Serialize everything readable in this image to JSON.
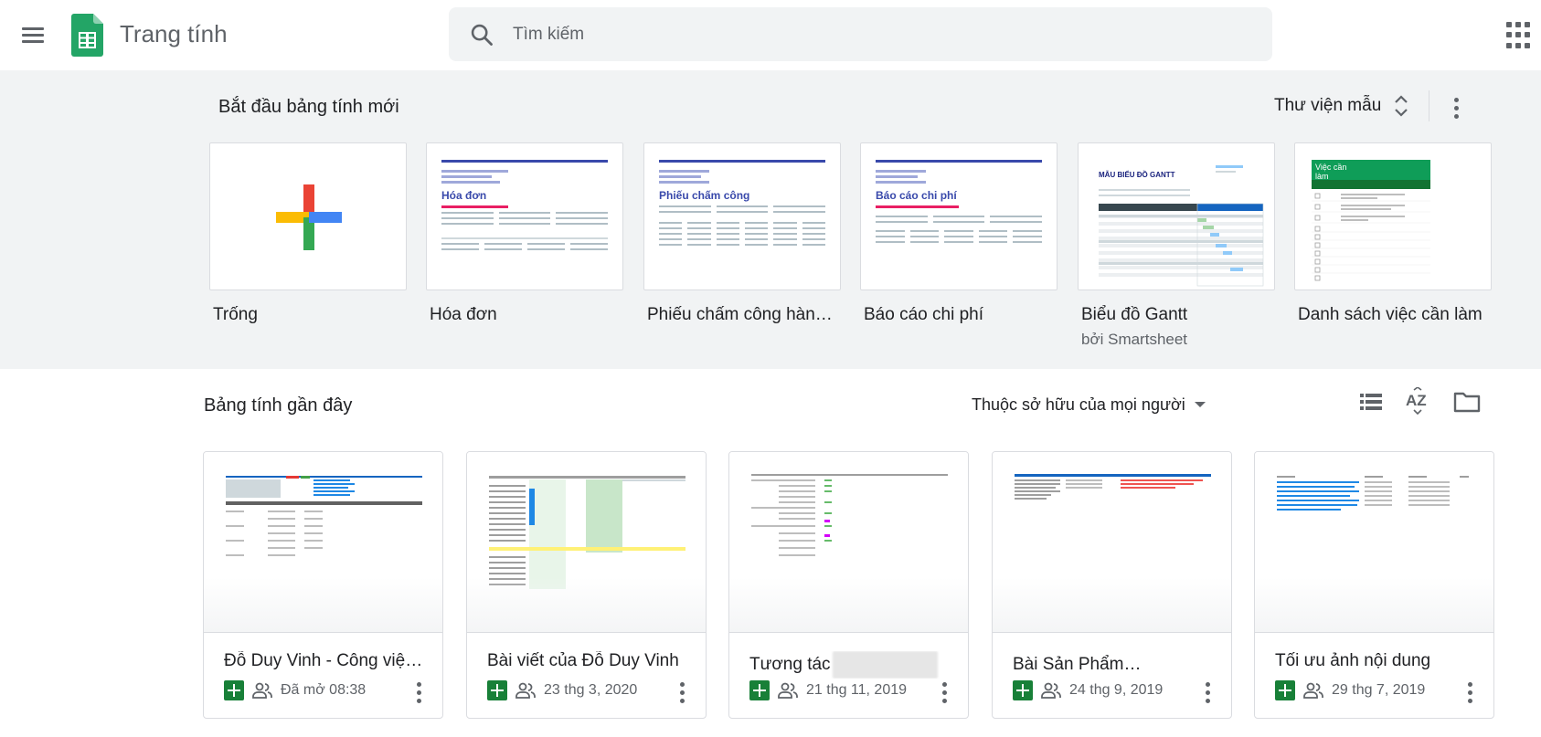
{
  "header": {
    "menu_icon": "hamburger-menu-icon",
    "app_title": "Trang tính",
    "search_placeholder": "Tìm kiếm",
    "apps_icon": "google-apps-grid-icon"
  },
  "templates": {
    "section_title": "Bắt đầu bảng tính mới",
    "gallery_label": "Thư viện mẫu",
    "items": [
      {
        "name": "Trống",
        "subtitle": ""
      },
      {
        "name": "Hóa đơn",
        "subtitle": ""
      },
      {
        "name": "Phiếu chấm công hàng ...",
        "subtitle": ""
      },
      {
        "name": "Báo cáo chi phí",
        "subtitle": ""
      },
      {
        "name": "Biểu đồ Gantt",
        "subtitle": "bởi Smartsheet"
      },
      {
        "name": "Danh sách việc cần làm",
        "subtitle": ""
      }
    ],
    "thumb_text": {
      "invoice": "Hóa đơn",
      "timesheet": "Phiếu chấm công",
      "expense": "Báo cáo chi phí",
      "gantt": "MẪU BIỂU ĐỒ GANTT",
      "todo": "Việc cần làm"
    }
  },
  "recent": {
    "section_title": "Bảng tính gần đây",
    "owner_filter": "Thuộc sở hữu của mọi người",
    "files": [
      {
        "name": "Đỗ Duy Vinh - Công việc ...",
        "time": "Đã mở 08:38",
        "redacted": false
      },
      {
        "name": "Bài viết của Đỗ Duy Vinh",
        "time": "23 thg 3, 2020",
        "redacted": false
      },
      {
        "name": "Tương tác",
        "time": "21 thg 11, 2019",
        "redacted": true
      },
      {
        "name": "Bài Sản Phẩm",
        "time": "24 thg 9, 2019",
        "redacted": true
      },
      {
        "name": "Tối ưu ảnh nội dung",
        "time": "29 thg 7, 2019",
        "redacted": false
      }
    ]
  },
  "colors": {
    "accent_green": "#188038",
    "header_bg": "#ffffff",
    "section_bg": "#f1f3f4"
  }
}
